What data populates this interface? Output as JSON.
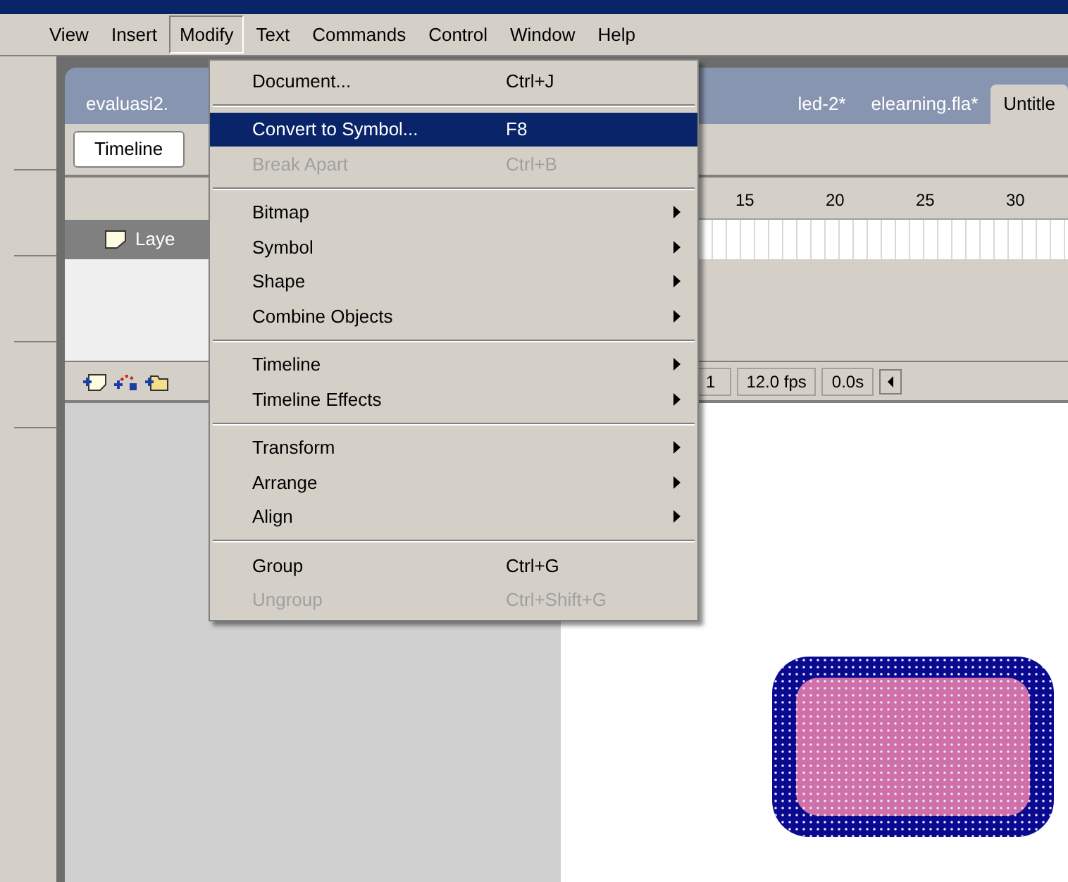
{
  "menu_bar": [
    {
      "label": "View",
      "selected": false
    },
    {
      "label": "Insert",
      "selected": false
    },
    {
      "label": "Modify",
      "selected": true
    },
    {
      "label": "Text",
      "selected": false
    },
    {
      "label": "Commands",
      "selected": false
    },
    {
      "label": "Control",
      "selected": false
    },
    {
      "label": "Window",
      "selected": false
    },
    {
      "label": "Help",
      "selected": false
    }
  ],
  "document_tabs": [
    {
      "label": "evaluasi2.",
      "selected": false
    },
    {
      "label": "led-2*",
      "selected": false
    },
    {
      "label": "elearning.fla*",
      "selected": false
    },
    {
      "label": "Untitle",
      "selected": true
    }
  ],
  "timeline_button": "Timeline",
  "frame_ruler": [
    "15",
    "20",
    "25",
    "30"
  ],
  "layers": [
    {
      "name": "Laye",
      "selected": true
    }
  ],
  "timeline_status": {
    "current_frame": "1",
    "frame_rate": "12.0 fps",
    "elapsed_time": "0.0s"
  },
  "modify_menu": [
    {
      "kind": "item",
      "label": "Document...",
      "shortcut": "Ctrl+J",
      "submenu": false,
      "disabled": false,
      "selected": false
    },
    {
      "kind": "separator"
    },
    {
      "kind": "item",
      "label": "Convert to Symbol...",
      "shortcut": "F8",
      "submenu": false,
      "disabled": false,
      "selected": true
    },
    {
      "kind": "item",
      "label": "Break Apart",
      "shortcut": "Ctrl+B",
      "submenu": false,
      "disabled": true,
      "selected": false
    },
    {
      "kind": "separator"
    },
    {
      "kind": "item",
      "label": "Bitmap",
      "submenu": true,
      "disabled": false,
      "selected": false
    },
    {
      "kind": "item",
      "label": "Symbol",
      "submenu": true,
      "disabled": false,
      "selected": false
    },
    {
      "kind": "item",
      "label": "Shape",
      "submenu": true,
      "disabled": false,
      "selected": false
    },
    {
      "kind": "item",
      "label": "Combine Objects",
      "submenu": true,
      "disabled": false,
      "selected": false
    },
    {
      "kind": "separator"
    },
    {
      "kind": "item",
      "label": "Timeline",
      "submenu": true,
      "disabled": false,
      "selected": false
    },
    {
      "kind": "item",
      "label": "Timeline Effects",
      "submenu": true,
      "disabled": false,
      "selected": false
    },
    {
      "kind": "separator"
    },
    {
      "kind": "item",
      "label": "Transform",
      "submenu": true,
      "disabled": false,
      "selected": false
    },
    {
      "kind": "item",
      "label": "Arrange",
      "submenu": true,
      "disabled": false,
      "selected": false
    },
    {
      "kind": "item",
      "label": "Align",
      "submenu": true,
      "disabled": false,
      "selected": false
    },
    {
      "kind": "separator"
    },
    {
      "kind": "item",
      "label": "Group",
      "shortcut": "Ctrl+G",
      "submenu": false,
      "disabled": false,
      "selected": false
    },
    {
      "kind": "item",
      "label": "Ungroup",
      "shortcut": "Ctrl+Shift+G",
      "submenu": false,
      "disabled": true,
      "selected": false
    }
  ]
}
